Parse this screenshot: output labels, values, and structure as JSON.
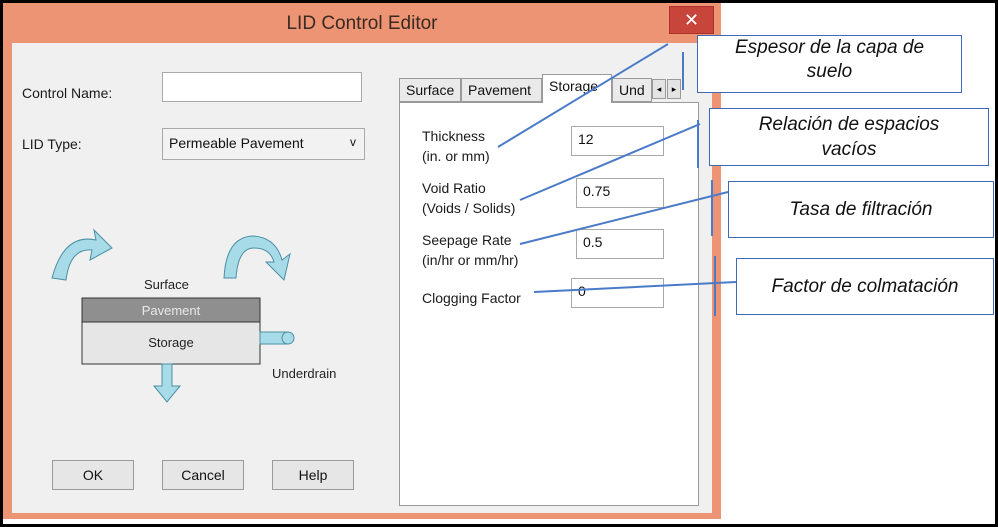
{
  "window": {
    "title": "LID Control Editor",
    "close_glyph": "✕"
  },
  "left": {
    "control_name_label": "Control Name:",
    "control_name_value": "",
    "lid_type_label": "LID Type:",
    "lid_type_value": "Permeable Pavement",
    "lid_type_chevron": "v"
  },
  "diagram": {
    "surface": "Surface",
    "pavement": "Pavement",
    "storage": "Storage",
    "underdrain": "Underdrain"
  },
  "buttons": {
    "ok": "OK",
    "cancel": "Cancel",
    "help": "Help"
  },
  "tabs": {
    "items": [
      "Surface",
      "Pavement",
      "Storage",
      "Und"
    ],
    "active_index": 2,
    "scroll_left": "◂",
    "scroll_right": "▸"
  },
  "storage": {
    "thickness_label_1": "Thickness",
    "thickness_label_2": "(in. or mm)",
    "thickness_value": "12",
    "void_label_1": "Void Ratio",
    "void_label_2": "(Voids / Solids)",
    "void_value": "0.75",
    "seepage_label_1": "Seepage Rate",
    "seepage_label_2": "(in/hr or mm/hr)",
    "seepage_value": "0.5",
    "clogging_label": "Clogging Factor",
    "clogging_value": "0"
  },
  "callouts": {
    "thickness_1": "Espesor de la capa de",
    "thickness_2": "suelo",
    "void_1": "Relación de espacios",
    "void_2": "vacíos",
    "seepage": "Tasa de filtración",
    "clogging": "Factor de colmatación"
  },
  "colors": {
    "title_bar": "#ec9474",
    "close_button": "#c7453a",
    "dialog_client": "#f0f0f0",
    "callout_border": "#3e6ab5",
    "leader_line": "#4a7bc8",
    "arrow_fill": "#a8dbe8"
  }
}
